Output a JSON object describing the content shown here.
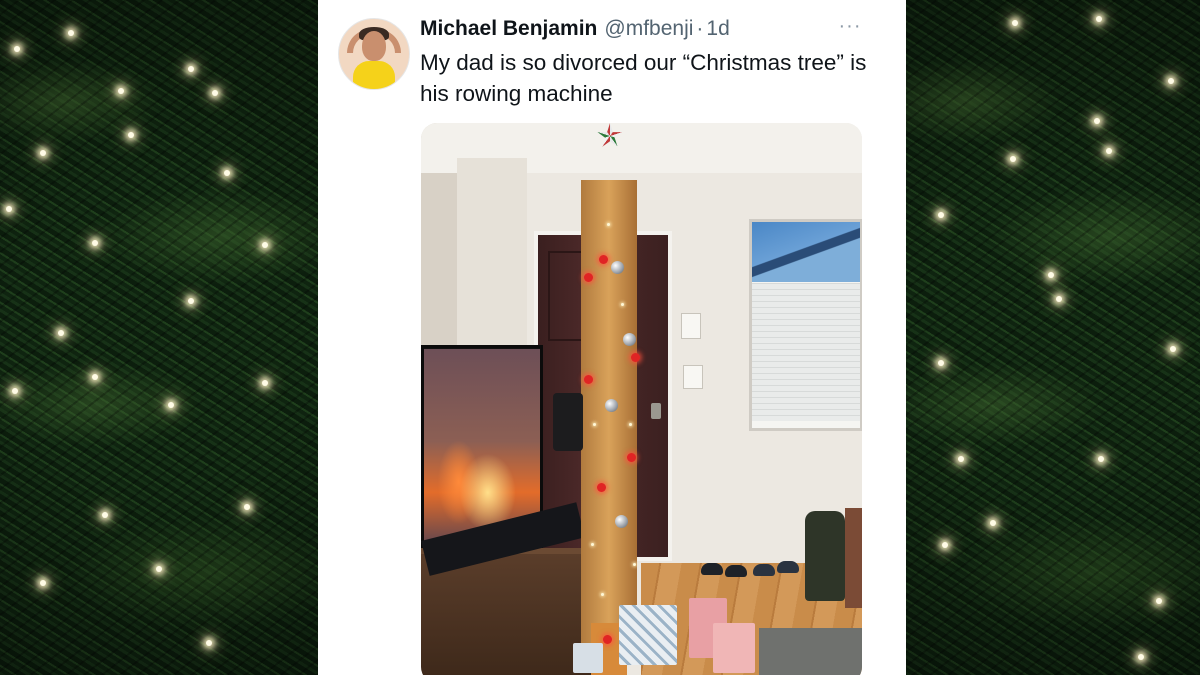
{
  "tweet": {
    "author_name": "Michael Benjamin",
    "handle": "@mfbenji",
    "separator": "·",
    "time": "1d",
    "more_label": "···",
    "text": "My dad is so divorced our “Christmas tree” is his rowing machine"
  },
  "icons": {
    "more": "more-options-icon",
    "avatar": "profile-avatar"
  },
  "colors": {
    "card_background": "#ffffff",
    "primary_text": "#0f1419",
    "secondary_text": "#536471",
    "background_tree": "#10260f"
  }
}
